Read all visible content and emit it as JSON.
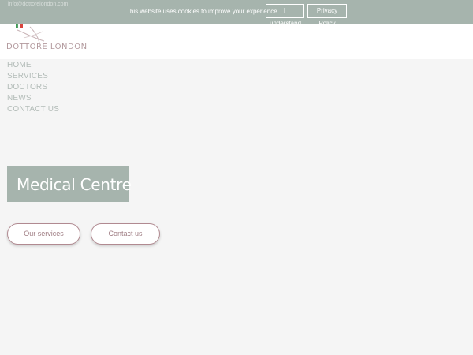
{
  "top_bar": {
    "email": "info@dottorelondon.com"
  },
  "cookie_bar": {
    "message": "This website uses cookies to improve your experience.",
    "accept_label": "I understand",
    "privacy_label": "Privacy Policy"
  },
  "logo": {
    "text": "DOTTORE LONDON"
  },
  "nav": {
    "items": [
      {
        "label": "HOME"
      },
      {
        "label": "SERVICES"
      },
      {
        "label": "DOCTORS"
      },
      {
        "label": "NEWS"
      },
      {
        "label": "CONTACT US"
      }
    ]
  },
  "hero": {
    "title": "Medical Centre",
    "services_button": "Our services",
    "contact_button": "Contact us"
  },
  "colors": {
    "accent_green": "#a6b4ad",
    "accent_rose": "#b18a91",
    "background": "#f5f5f5"
  }
}
